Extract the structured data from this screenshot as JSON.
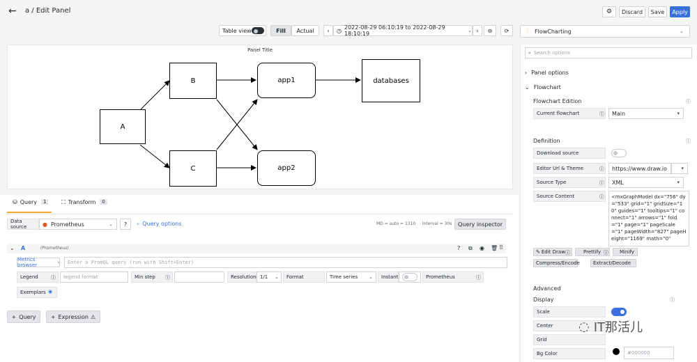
{
  "header": {
    "title": "a / Edit Panel",
    "discard": "Discard",
    "save": "Save",
    "apply": "Apply"
  },
  "toolbar": {
    "table_view": "Table view",
    "fill": "Fill",
    "actual": "Actual",
    "time_range": "2022-08-29 06:10:19 to 2022-08-29 18:10:19",
    "visualization": "FlowCharting"
  },
  "panel": {
    "title": "Panel Title",
    "nodes": {
      "a": "A",
      "b": "B",
      "c": "C",
      "app1": "app1",
      "app2": "app2",
      "db": "databases"
    }
  },
  "tabs": {
    "query": "Query",
    "query_count": "1",
    "transform": "Transform",
    "transform_count": "0"
  },
  "datasource": {
    "label": "Data source",
    "value": "Prometheus",
    "query_options": "Query options",
    "meta": "MD = auto = 1310     Interval = 30s",
    "inspector": "Query inspector"
  },
  "query": {
    "letter": "A",
    "source": "(Prometheus)",
    "metrics_browser": "Metrics browser",
    "placeholder": "Enter a PromQL query (run with Shift+Enter)",
    "legend": "Legend",
    "legend_placeholder": "legend format",
    "min_step": "Min step",
    "resolution": "Resolution",
    "resolution_value": "1/1",
    "format": "Format",
    "format_value": "Time series",
    "instant": "Instant",
    "prometheus": "Prometheus",
    "exemplars": "Exemplars",
    "add_query": "Query",
    "add_expression": "Expression"
  },
  "options": {
    "search_placeholder": "Search options",
    "panel_options": "Panel options",
    "flowchart": "Flowchart",
    "flowchart_edition": "Flowchart Edition",
    "current_flowchart": "Current flowchart",
    "current_flowchart_value": "Main",
    "definition": "Definition",
    "download_source": "Download source",
    "editor_url": "Editor Url & Theme",
    "editor_url_value": "https://www.draw.io",
    "source_type": "Source Type",
    "source_type_value": "XML",
    "source_content": "Source Content",
    "source_content_value": "<mxGraphModel dx=\"756\" dy=\"533\" grid=\"1\" gridSize=\"10\" guides=\"1\" tooltips=\"1\" connect=\"1\" arrows=\"1\" fold=\"1\" page=\"1\" pageScale=\"1\" pageWidth=\"827\" pageHeight=\"1169\" math=\"0\"",
    "edit_draw": "Edit Draw",
    "prettify": "Prettify",
    "minify": "Minify",
    "compress": "Compress/Encode",
    "extract": "Extract/Decode",
    "advanced": "Advanced",
    "display": "Display",
    "scale": "Scale",
    "center": "Center",
    "grid": "Grid",
    "bg_color": "Bg Color",
    "bg_color_value": "#000000"
  },
  "watermark": "IT那活儿"
}
